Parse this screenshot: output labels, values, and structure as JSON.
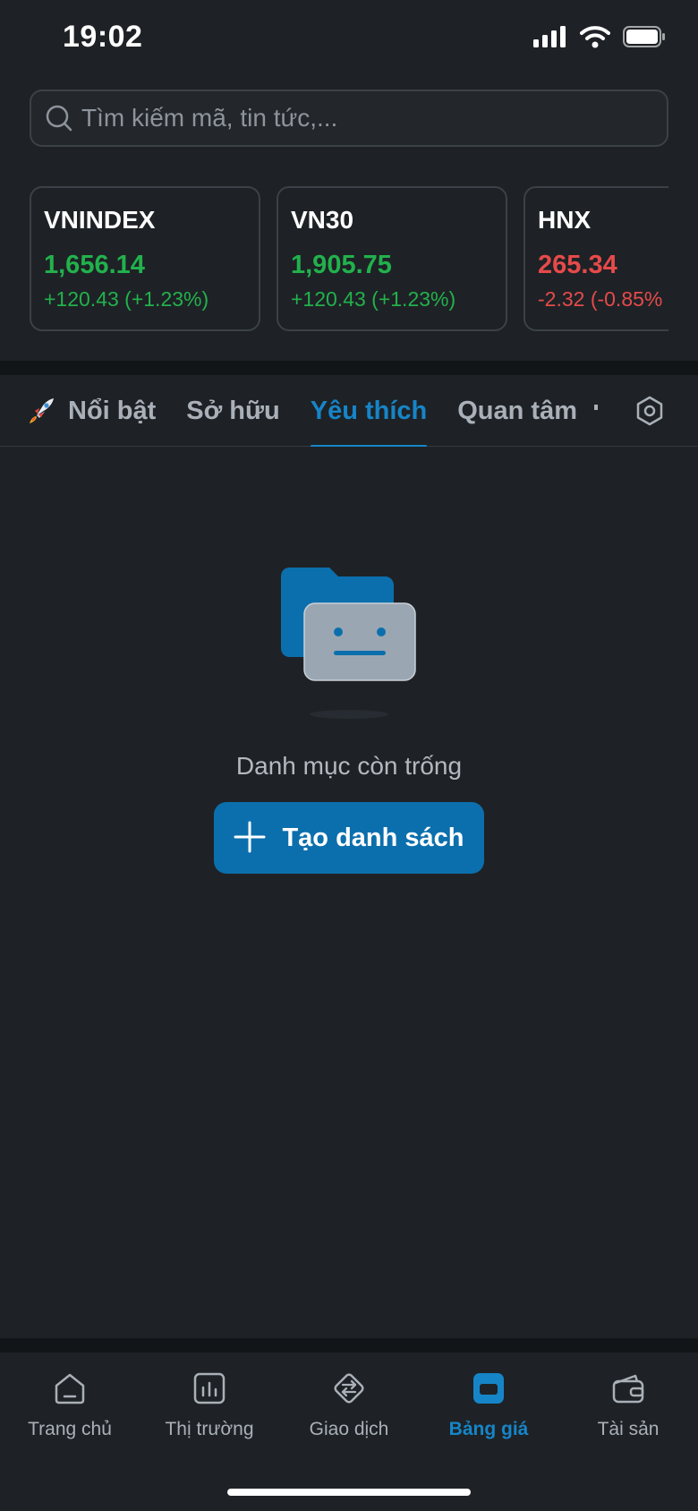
{
  "status_bar": {
    "time": "19:02",
    "icons": [
      "signal-icon",
      "wifi-icon",
      "battery-icon"
    ]
  },
  "search": {
    "placeholder": "Tìm kiếm mã, tin tức,...",
    "value": ""
  },
  "indices": [
    {
      "name": "VNINDEX",
      "value": "1,656.14",
      "change": "+120.43 (+1.23%)",
      "trend": "up"
    },
    {
      "name": "VN30",
      "value": "1,905.75",
      "change": "+120.43 (+1.23%)",
      "trend": "up"
    },
    {
      "name": "HNX",
      "value": "265.34",
      "change": "-2.32 (-0.85%",
      "trend": "down"
    }
  ],
  "tabs": {
    "items": [
      {
        "label": "Nổi bật",
        "icon": "rocket-icon"
      },
      {
        "label": "Sở hữu"
      },
      {
        "label": "Yêu thích",
        "active": true
      },
      {
        "label": "Quan tâm"
      }
    ],
    "settings_icon": "settings-icon"
  },
  "empty_state": {
    "illustration": "empty-folder-icon",
    "message": "Danh mục còn trống",
    "button_label": "Tạo danh sách",
    "button_icon": "plus-icon"
  },
  "bottom_nav": {
    "items": [
      {
        "label": "Trang chủ",
        "icon": "home-icon"
      },
      {
        "label": "Thị trường",
        "icon": "market-chart-icon"
      },
      {
        "label": "Giao dịch",
        "icon": "trade-exchange-icon"
      },
      {
        "label": "Bảng giá",
        "icon": "price-board-icon",
        "active": true
      },
      {
        "label": "Tài sản",
        "icon": "wallet-icon"
      }
    ]
  },
  "colors": {
    "background": "#1e2226",
    "accent": "#1685c8",
    "button": "#0c6fad",
    "up": "#22b14c",
    "down": "#e64a4a"
  }
}
